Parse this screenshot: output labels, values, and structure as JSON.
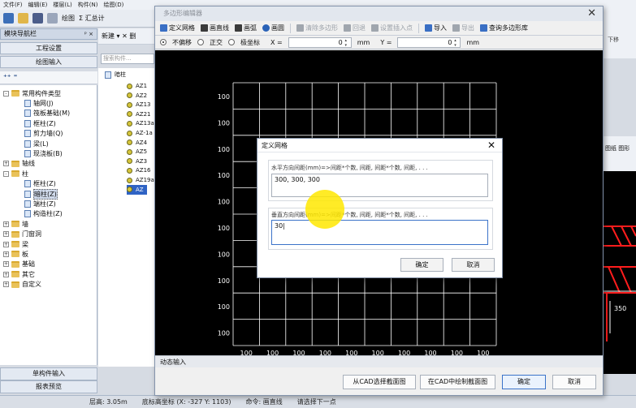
{
  "menu": [
    "文件(F)",
    "编辑(E)",
    "楼层(L)",
    "构件(N)",
    "绘图(D)"
  ],
  "toolbar": {
    "draw": "绘图",
    "sum": "Σ 汇总计"
  },
  "nav": {
    "title": "模块导航栏",
    "pin": "ᵖ ×",
    "tabs": [
      "工程设置",
      "绘图输入"
    ],
    "tree": [
      {
        "label": "常用构件类型",
        "kind": "folder",
        "exp": "-"
      },
      {
        "label": "轴网(J)",
        "kind": "item"
      },
      {
        "label": "筏板基础(M)",
        "kind": "item"
      },
      {
        "label": "框柱(Z)",
        "kind": "item"
      },
      {
        "label": "剪力墙(Q)",
        "kind": "item"
      },
      {
        "label": "梁(L)",
        "kind": "item"
      },
      {
        "label": "现浇板(B)",
        "kind": "item"
      },
      {
        "label": "轴线",
        "kind": "folder",
        "exp": "+"
      },
      {
        "label": "柱",
        "kind": "folder",
        "exp": "-"
      },
      {
        "label": "框柱(Z)",
        "kind": "item"
      },
      {
        "label": "暗柱(Z)",
        "kind": "item",
        "selected": true
      },
      {
        "label": "端柱(Z)",
        "kind": "item"
      },
      {
        "label": "构造柱(Z)",
        "kind": "item"
      },
      {
        "label": "墙",
        "kind": "folder",
        "exp": "+"
      },
      {
        "label": "门窗洞",
        "kind": "folder",
        "exp": "+"
      },
      {
        "label": "梁",
        "kind": "folder",
        "exp": "+"
      },
      {
        "label": "板",
        "kind": "folder",
        "exp": "+"
      },
      {
        "label": "基础",
        "kind": "folder",
        "exp": "+"
      },
      {
        "label": "其它",
        "kind": "folder",
        "exp": "+"
      },
      {
        "label": "自定义",
        "kind": "folder",
        "exp": "+"
      }
    ],
    "bottom": [
      "单构件输入",
      "报表预览"
    ]
  },
  "components": {
    "new_label": "新建 ▾  ✕ 删",
    "search_placeholder": "搜索构件...",
    "root": "暗柱",
    "items": [
      "AZ1",
      "AZ2",
      "AZ13",
      "AZ21",
      "AZ13a",
      "AZ-1a",
      "AZ4",
      "AZ5",
      "AZ3",
      "AZ16",
      "AZ19a",
      "AZ"
    ]
  },
  "right_app": {
    "tab": "下移",
    "panel": "图纸",
    "panel2": "图形",
    "cad_label": "350"
  },
  "status": [
    "层高: 3.05m",
    "底标高坐标 (X: -327 Y: 1103)",
    "命令: 画直线",
    "请选择下一点"
  ],
  "editor": {
    "title": "多边形编辑器",
    "tools": [
      {
        "label": "定义网格",
        "icon": "grid-icon",
        "enabled": true
      },
      {
        "label": "画直线",
        "icon": "line-icon",
        "enabled": true
      },
      {
        "label": "画弧",
        "icon": "arc-icon",
        "enabled": true
      },
      {
        "label": "画圆",
        "icon": "circle-icon",
        "enabled": true
      },
      {
        "label": "清除多边形",
        "icon": "clear-icon",
        "enabled": false
      },
      {
        "label": "回退",
        "icon": "undo-icon",
        "enabled": false
      },
      {
        "label": "设置插入点",
        "icon": "insert-point-icon",
        "enabled": false
      },
      {
        "label": "导入",
        "icon": "import-icon",
        "enabled": true
      },
      {
        "label": "导出",
        "icon": "export-icon",
        "enabled": false
      },
      {
        "label": "查询多边形库",
        "icon": "search-icon",
        "enabled": true
      }
    ],
    "modes": [
      {
        "label": "不偏移",
        "selected": true
      },
      {
        "label": "正交",
        "selected": false
      },
      {
        "label": "极坐标",
        "selected": false
      }
    ],
    "x_label": "X =",
    "x_value": "0",
    "y_label": "Y =",
    "y_value": "0",
    "unit": "mm",
    "grid_label": "100",
    "dyn_input": "动态输入",
    "buttons": {
      "cad_select": "从CAD选择截面图",
      "cad_draw": "在CAD中绘制截面图",
      "ok": "确定",
      "cancel": "取消"
    }
  },
  "dialog": {
    "title": "定义网格",
    "h_label": "水平方向间距(mm)=>间距*个数, 间距, 间距*个数, 间距, . . .",
    "h_value": "300, 300, 300",
    "v_label": "垂直方向间距(mm)=>间距*个数, 间距, 间距*个数, 间距, . . .",
    "v_value": "30|",
    "ok": "确定",
    "cancel": "取消"
  },
  "colors": {
    "grid": "#ffffff",
    "accent": "#2f63c4",
    "cad_red": "#ff0000",
    "highlight": "#ffe800"
  }
}
